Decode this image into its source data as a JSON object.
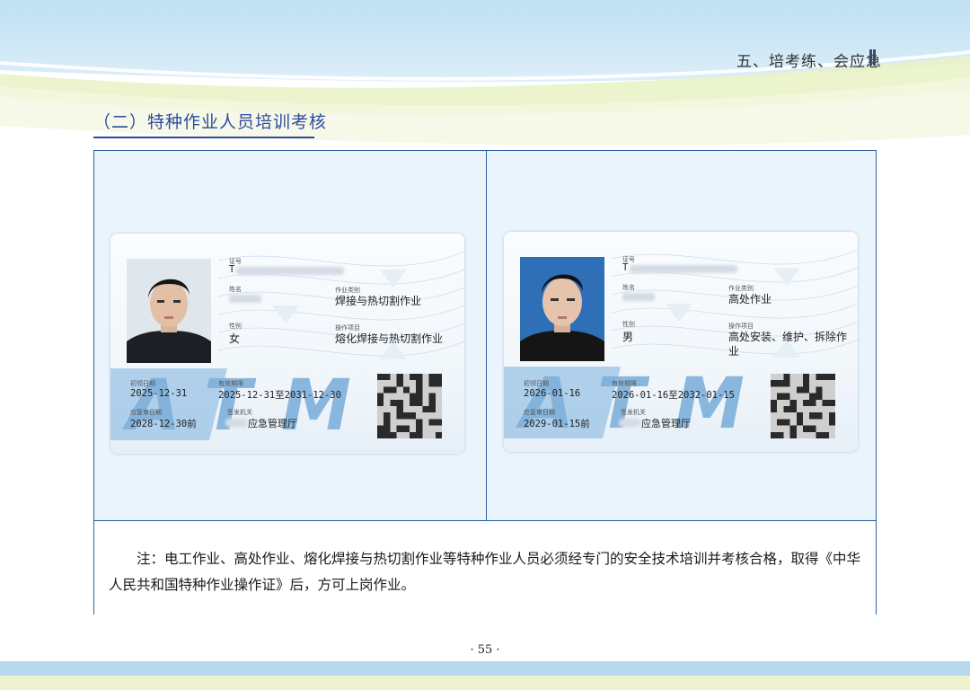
{
  "header": {
    "chapter": "五、培考练、会应急"
  },
  "section_title": "（二）特种作业人员培训考核",
  "cards": [
    {
      "labels": {
        "cert_no": "证号",
        "name": "姓名",
        "gender": "性别",
        "category": "作业类别",
        "item": "操作项目",
        "first_issue": "初领日期",
        "validity": "有效期限",
        "review": "应复审日期",
        "issuer": "签发机关"
      },
      "cert_prefix": "T",
      "gender": "女",
      "category": "焊接与热切割作业",
      "item_line1": "熔化焊接与热切割作业",
      "item_line2": "",
      "first_issue_date": "2025-12-31",
      "validity_period": "2025-12-31至2031-12-30",
      "review_date": "2028-12-30前",
      "issuer": "应急管理厅",
      "emblem": "ATM"
    },
    {
      "labels": {
        "cert_no": "证号",
        "name": "姓名",
        "gender": "性别",
        "category": "作业类别",
        "item": "操作项目",
        "first_issue": "初领日期",
        "validity": "有效期限",
        "review": "应复审日期",
        "issuer": "签发机关"
      },
      "cert_prefix": "T",
      "gender": "男",
      "category": "高处作业",
      "item_line1": "高处安装、维护、拆除作",
      "item_line2": "业",
      "first_issue_date": "2026-01-16",
      "validity_period": "2026-01-16至2032-01-15",
      "review_date": "2029-01-15前",
      "issuer": "应急管理厅",
      "emblem": "ATM"
    }
  ],
  "note": "注：电工作业、高处作业、熔化焊接与热切割作业等特种作业人员必须经专门的安全技术培训并考核合格，取得《中华人民共和国特种作业操作证》后，方可上岗作业。",
  "page_number": "· 55 ·",
  "colors": {
    "accent_blue": "#2d4aa0",
    "frame_border": "#2a5fa0",
    "frame_fill": "#eaf4fc",
    "band_blue": "#b8d8ee",
    "band_green": "#edf2cf"
  }
}
